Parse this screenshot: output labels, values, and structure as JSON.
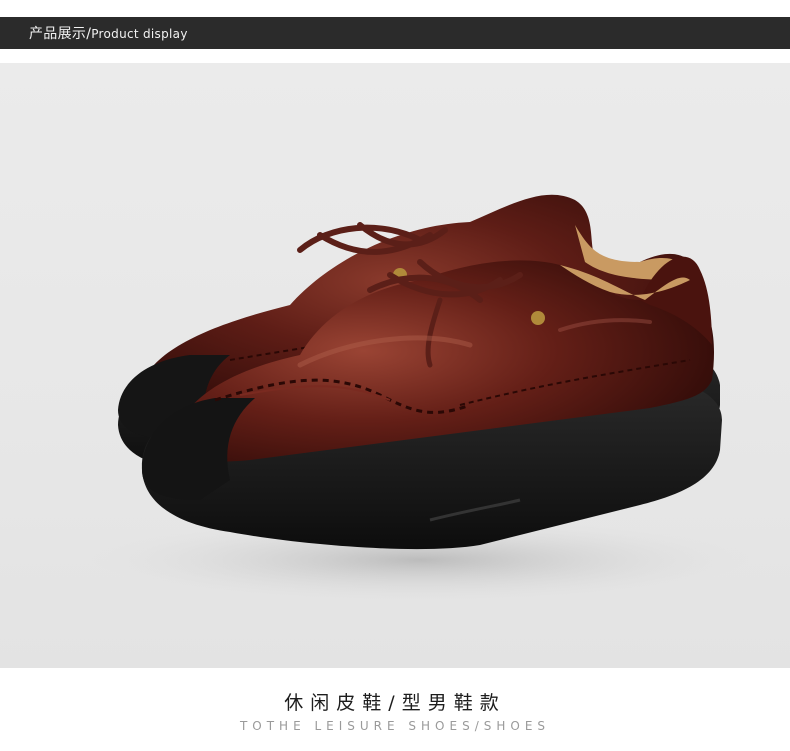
{
  "header": {
    "title_cn": "产品展示",
    "separator": "/",
    "title_en": "Product display",
    "background_color": "#2b2b2b"
  },
  "product_image": {
    "subject": "brown-leather-lace-up-shoes",
    "leather_color": "#5a1a14",
    "sole_color": "#1a1a1a",
    "background_color": "#e8e8e8"
  },
  "caption": {
    "main": "休闲皮鞋/型男鞋款",
    "sub": "TOTHE LEISURE SHOES/SHOES"
  }
}
